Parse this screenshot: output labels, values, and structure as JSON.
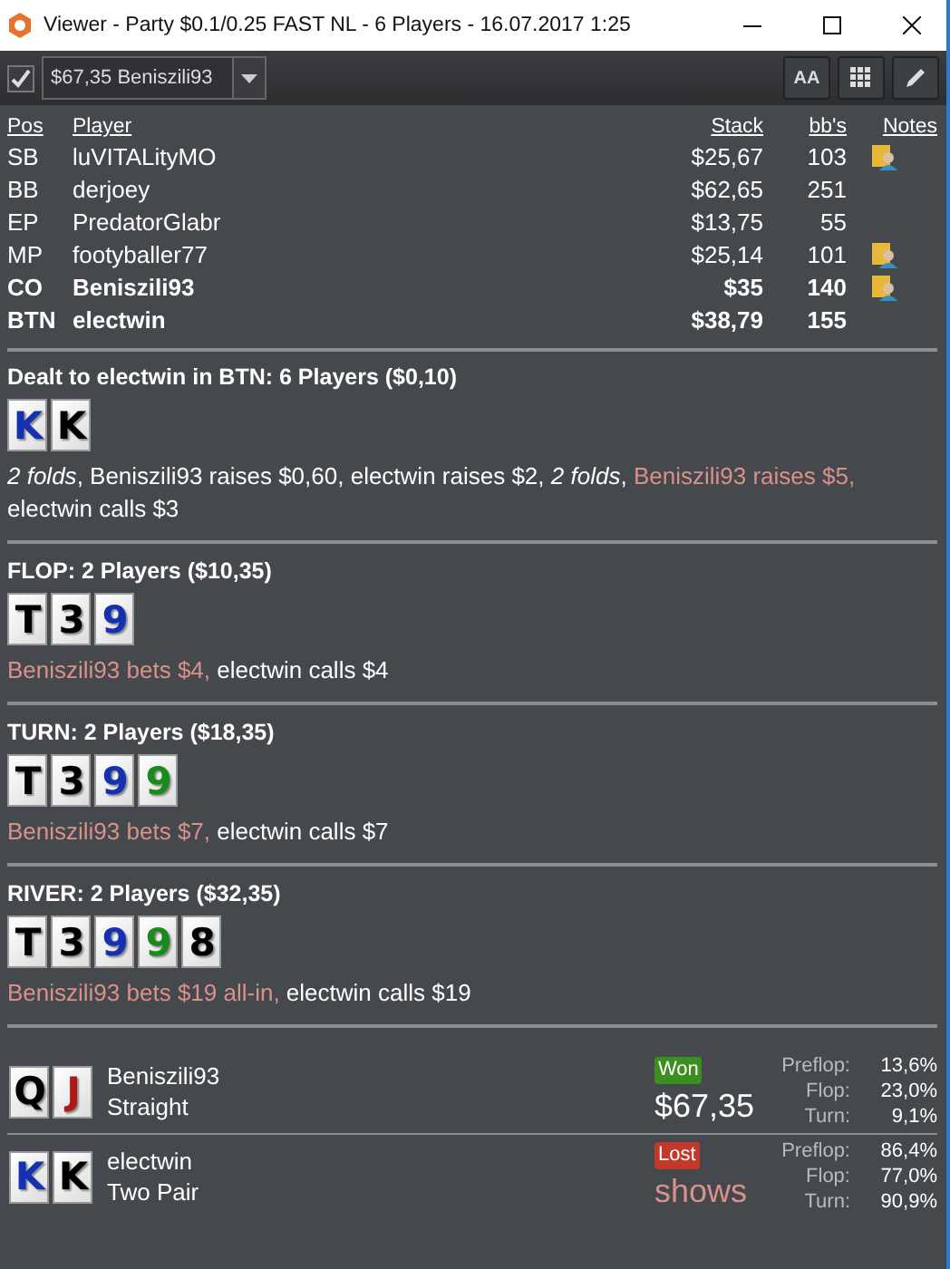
{
  "window": {
    "title": "Viewer - Party $0.1/0.25 FAST NL - 6 Players - 16.07.2017 1:25"
  },
  "toolbar": {
    "filter_checked": true,
    "hand_select": {
      "value": "$67,35 Beniszili93"
    },
    "buttons": [
      {
        "kind": "font",
        "label": "AA"
      },
      {
        "kind": "grid"
      },
      {
        "kind": "edit"
      }
    ]
  },
  "players": {
    "columns": [
      "Pos",
      "Player",
      "Stack",
      "bb's",
      "Notes"
    ],
    "rows": [
      {
        "pos": "SB",
        "player": "luVITALityMO",
        "stack": "$25,67",
        "bbs": "103",
        "note": true,
        "highlighted": false
      },
      {
        "pos": "BB",
        "player": "derjoey",
        "stack": "$62,65",
        "bbs": "251",
        "note": false,
        "highlighted": false
      },
      {
        "pos": "EP",
        "player": "PredatorGlabr",
        "stack": "$13,75",
        "bbs": "55",
        "note": false,
        "highlighted": false
      },
      {
        "pos": "MP",
        "player": "footyballer77",
        "stack": "$25,14",
        "bbs": "101",
        "note": true,
        "highlighted": false
      },
      {
        "pos": "CO",
        "player": "Beniszili93",
        "stack": "$35",
        "bbs": "140",
        "note": true,
        "highlighted": true
      },
      {
        "pos": "BTN",
        "player": "electwin",
        "stack": "$38,79",
        "bbs": "155",
        "note": false,
        "highlighted": true
      }
    ]
  },
  "streets": [
    {
      "title": "Dealt to electwin in BTN: 6 Players ($0,10)",
      "cards": [
        {
          "rank": "K",
          "color": "#1530b0"
        },
        {
          "rank": "K",
          "color": "#000000"
        }
      ],
      "actions": [
        {
          "kind": "fold",
          "text": "2 folds"
        },
        {
          "kind": "normal",
          "text": ", Beniszili93 raises $0,60, electwin raises $2, "
        },
        {
          "kind": "fold",
          "text": "2 folds"
        },
        {
          "kind": "normal",
          "text": ", "
        },
        {
          "kind": "aggressive",
          "text": "Beniszili93 raises $5,"
        },
        {
          "kind": "normal",
          "text": " electwin calls $3"
        }
      ]
    },
    {
      "title": "FLOP: 2 Players ($10,35)",
      "cards": [
        {
          "rank": "T",
          "color": "#000000"
        },
        {
          "rank": "3",
          "color": "#000000"
        },
        {
          "rank": "9",
          "color": "#1530b0"
        }
      ],
      "actions": [
        {
          "kind": "aggressive",
          "text": "Beniszili93 bets $4,"
        },
        {
          "kind": "normal",
          "text": " electwin calls $4"
        }
      ]
    },
    {
      "title": "TURN: 2 Players ($18,35)",
      "cards": [
        {
          "rank": "T",
          "color": "#000000"
        },
        {
          "rank": "3",
          "color": "#000000"
        },
        {
          "rank": "9",
          "color": "#1530b0"
        },
        {
          "rank": "9",
          "color": "#1a8a1a"
        }
      ],
      "actions": [
        {
          "kind": "aggressive",
          "text": "Beniszili93 bets $7,"
        },
        {
          "kind": "normal",
          "text": " electwin calls $7"
        }
      ]
    },
    {
      "title": "RIVER: 2 Players ($32,35)",
      "cards": [
        {
          "rank": "T",
          "color": "#000000"
        },
        {
          "rank": "3",
          "color": "#000000"
        },
        {
          "rank": "9",
          "color": "#1530b0"
        },
        {
          "rank": "9",
          "color": "#1a8a1a"
        },
        {
          "rank": "8",
          "color": "#000000"
        }
      ],
      "actions": [
        {
          "kind": "aggressive",
          "text": "Beniszili93 bets $19 all-in,"
        },
        {
          "kind": "normal",
          "text": " electwin calls $19"
        }
      ]
    }
  ],
  "results": [
    {
      "cards": [
        {
          "rank": "Q",
          "color": "#000000"
        },
        {
          "rank": "J",
          "color": "#b01818"
        }
      ],
      "player": "Beniszili93",
      "hand": "Straight",
      "kind": "won",
      "badge": "Won",
      "amount": "$67,35",
      "stats": [
        {
          "label": "Preflop:",
          "value": "13,6%"
        },
        {
          "label": "Flop:",
          "value": "23,0%"
        },
        {
          "label": "Turn:",
          "value": "9,1%"
        }
      ]
    },
    {
      "cards": [
        {
          "rank": "K",
          "color": "#1530b0"
        },
        {
          "rank": "K",
          "color": "#000000"
        }
      ],
      "player": "electwin",
      "hand": "Two Pair",
      "kind": "lost",
      "badge": "Lost",
      "amount": "shows",
      "stats": [
        {
          "label": "Preflop:",
          "value": "86,4%"
        },
        {
          "label": "Flop:",
          "value": "77,0%"
        },
        {
          "label": "Turn:",
          "value": "90,9%"
        }
      ]
    }
  ]
}
